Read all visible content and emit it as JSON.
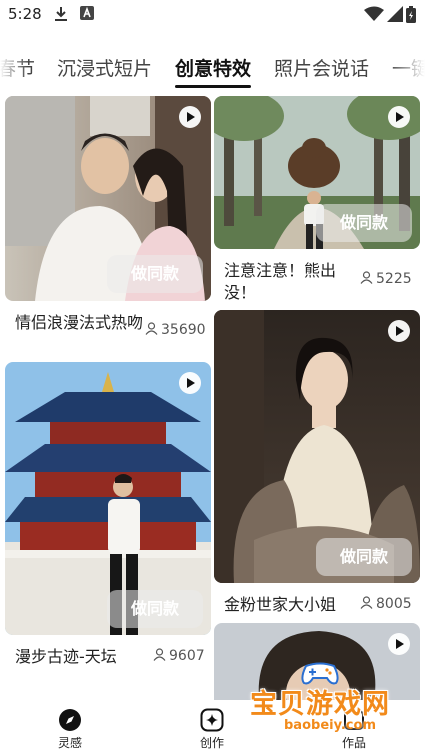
{
  "status_bar": {
    "time": "5:28"
  },
  "tabs": [
    {
      "label": "春节"
    },
    {
      "label": "沉浸式短片"
    },
    {
      "label": "创意特效"
    },
    {
      "label": "照片会说话"
    },
    {
      "label": "一键"
    }
  ],
  "cards": [
    {
      "title": "情侣浪漫法式热吻",
      "count": "35690",
      "button": "做同款"
    },
    {
      "title": "注意注意！熊出没！",
      "count": "5225",
      "button": "做同款"
    },
    {
      "title": "漫步古迹-天坛",
      "count": "9607",
      "button": "做同款"
    },
    {
      "title": "金粉世家大小姐",
      "count": "8005",
      "button": "做同款"
    }
  ],
  "bottom_nav": [
    {
      "label": "灵感"
    },
    {
      "label": "创作"
    },
    {
      "label": "作品"
    }
  ],
  "watermark": {
    "text": "宝贝游戏网",
    "url": "baobeiy.com"
  },
  "colors": {
    "accent": "#111111",
    "watermark": "#f28a1a"
  }
}
